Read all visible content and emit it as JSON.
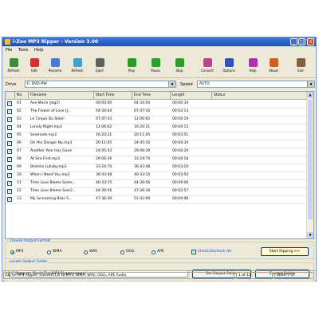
{
  "window": {
    "title": "i-Zoo MP3 Ripper - Version 3.00"
  },
  "menu": [
    "File",
    "Tools",
    "Help"
  ],
  "toolbar": [
    {
      "label": "Refresh"
    },
    {
      "label": "Edit"
    },
    {
      "label": "Rename"
    },
    {
      "label": "Refresh"
    },
    {
      "label": "Eject"
    },
    {
      "label": "Play"
    },
    {
      "label": "Pause"
    },
    {
      "label": "Stop"
    },
    {
      "label": "Convert"
    },
    {
      "label": "Options"
    },
    {
      "label": "Help"
    },
    {
      "label": "About"
    },
    {
      "label": "Exit"
    }
  ],
  "source": {
    "drive_label": "Drive",
    "drive_value": "E: DVD-RW",
    "speed_label": "Speed",
    "speed_value": "AUTO"
  },
  "columns": [
    "No.",
    "Filename",
    "Start Time",
    "End Time",
    "Length",
    "Status"
  ],
  "tracks": [
    {
      "no": "01",
      "name": "Ave Maria (Jag2)",
      "start": "00:00:00",
      "end": "04:34:04",
      "length": "00:04:34",
      "status": ""
    },
    {
      "no": "02",
      "name": "The Flower of Love (J...",
      "start": "04:34:04",
      "end": "07:47:43",
      "length": "00:03:13",
      "status": ""
    },
    {
      "no": "03",
      "name": "Le Cirque Du Soleil",
      "start": "07:47:43",
      "end": "12:06:62",
      "length": "00:04:19",
      "status": ""
    },
    {
      "no": "04",
      "name": "Lonely Night.mp3",
      "start": "12:06:62",
      "end": "16:20:21",
      "length": "00:04:13",
      "status": ""
    },
    {
      "no": "05",
      "name": "Serenade.mp3",
      "start": "16:20:21",
      "end": "20:11:05",
      "length": "00:03:51",
      "status": ""
    },
    {
      "no": "06",
      "name": "On the Danger No.mp3",
      "start": "20:11:05",
      "end": "24:45:43",
      "length": "00:04:34",
      "status": ""
    },
    {
      "no": "07",
      "name": "Another Year Has Gone",
      "start": "24:45:43",
      "end": "29:06:30",
      "length": "00:04:20",
      "status": ""
    },
    {
      "no": "08",
      "name": "At Sea First.mp3",
      "start": "29:06:30",
      "end": "33:24:70",
      "length": "00:04:18",
      "status": ""
    },
    {
      "no": "09",
      "name": "Brahms Lullaby.mp3",
      "start": "33:24:70",
      "end": "36:43:48",
      "length": "00:03:19",
      "status": ""
    },
    {
      "no": "10",
      "name": "When I Need You.mp3",
      "start": "36:43:48",
      "end": "40:33:15",
      "length": "00:03:50",
      "status": ""
    },
    {
      "no": "11",
      "name": "Time Love Blame Some...",
      "start": "40:33:15",
      "end": "44:39:56",
      "length": "00:04:06",
      "status": ""
    },
    {
      "no": "12",
      "name": "Time Love Blame Som2...",
      "start": "44:39:56",
      "end": "47:36:30",
      "length": "00:02:57",
      "status": ""
    },
    {
      "no": "13",
      "name": "My Screaming Bliss 5...",
      "start": "47:36:30",
      "end": "51:42:09",
      "length": "00:04:06",
      "status": ""
    }
  ],
  "format": {
    "group_label": "Choose Output Format",
    "options": [
      "MP3",
      "WMA",
      "WAV",
      "OGG",
      "APE"
    ],
    "selected": "MP3",
    "checkbox_label": "Check/Uncheck All",
    "rip_button": "Start Ripping >>"
  },
  "output": {
    "group_label": "Locate Output Folder",
    "path": "C:\\Program Files\\i-Zoo\\MP3 Ripper\\output\\",
    "set_button": "Set Output Folder",
    "explore_button": "Explore Folder"
  },
  "status": {
    "message": "CD to MP3 Ripper: Convert CD to MP3, WMA, WAV, OGG, APE Audio",
    "count": "1 of 13",
    "date": "2004-7-17"
  }
}
